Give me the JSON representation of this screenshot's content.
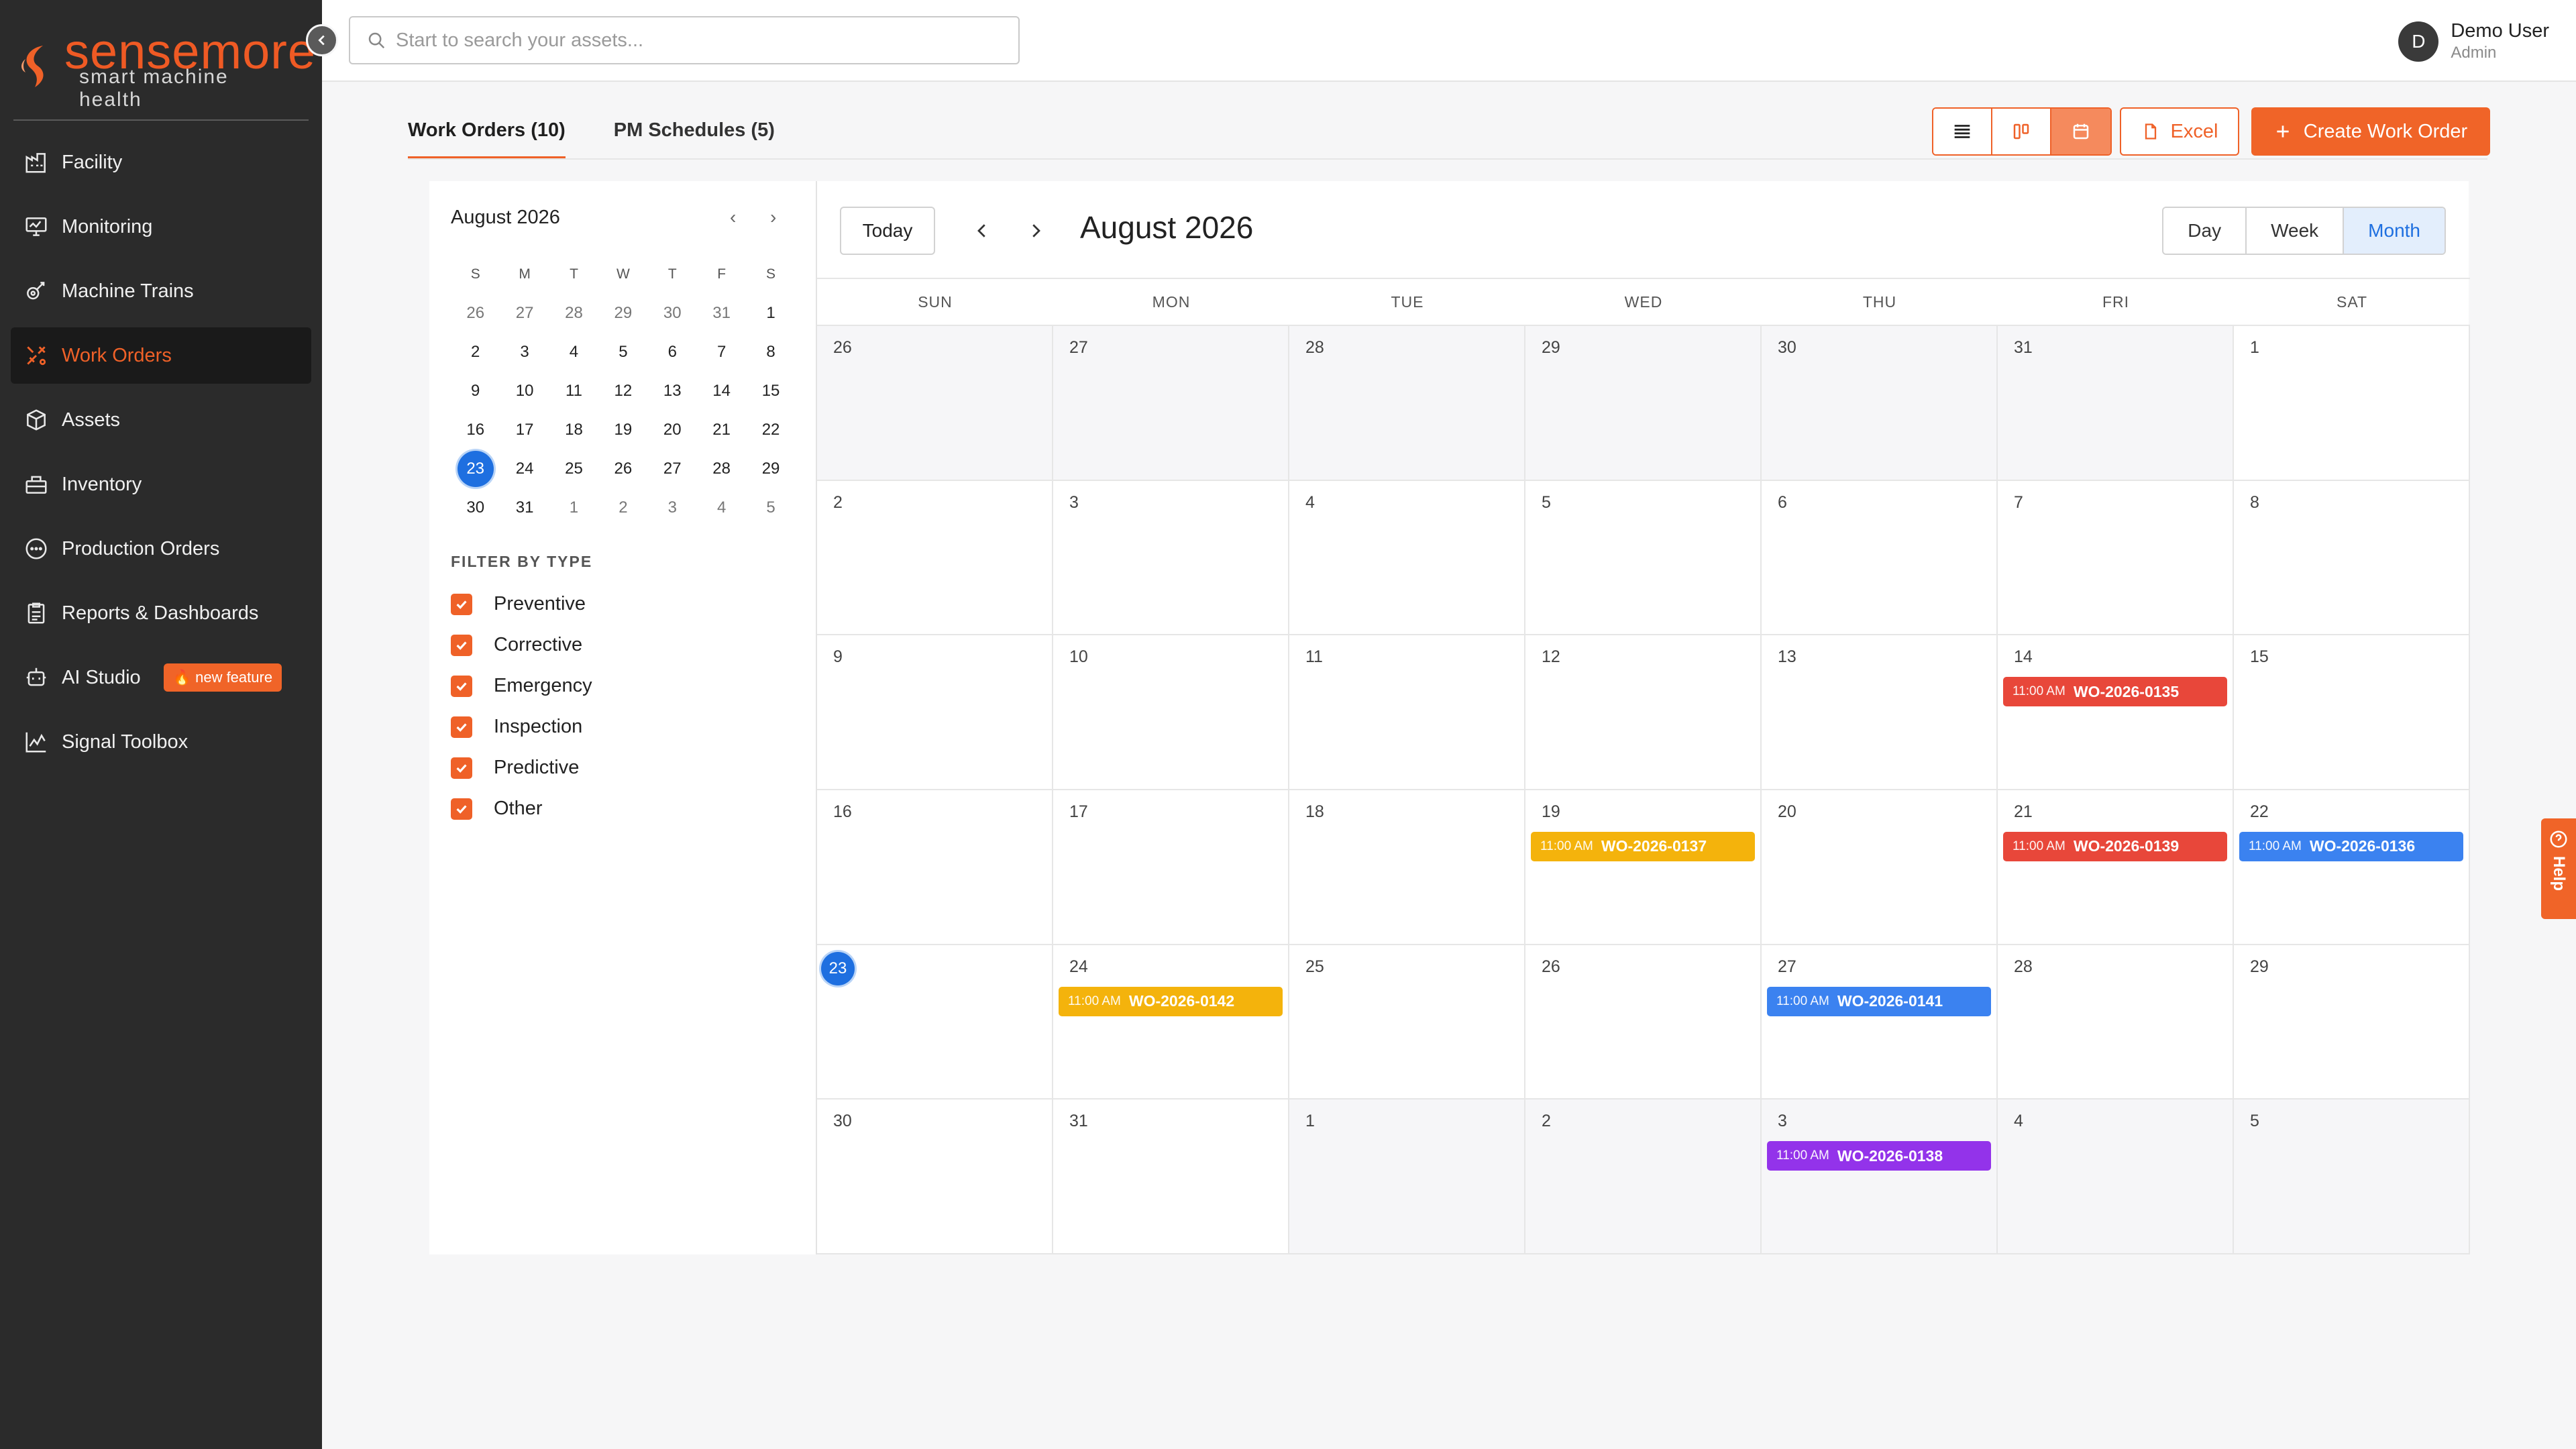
{
  "app": {
    "brand": "sensemore",
    "tagline": "smart machine health",
    "colors": {
      "accent": "#ef6128",
      "sidebar_bg": "#2b2b2b",
      "today_blue": "#1e6fe0"
    }
  },
  "sidebar": {
    "items": [
      {
        "label": "Facility",
        "icon": "facility-icon"
      },
      {
        "label": "Monitoring",
        "icon": "monitoring-icon"
      },
      {
        "label": "Machine Trains",
        "icon": "machine-trains-icon"
      },
      {
        "label": "Work Orders",
        "icon": "work-orders-icon",
        "active": true
      },
      {
        "label": "Assets",
        "icon": "assets-icon"
      },
      {
        "label": "Inventory",
        "icon": "inventory-icon"
      },
      {
        "label": "Production Orders",
        "icon": "production-orders-icon"
      },
      {
        "label": "Reports & Dashboards",
        "icon": "reports-icon"
      },
      {
        "label": "AI Studio",
        "icon": "ai-studio-icon",
        "badge": "new feature"
      },
      {
        "label": "Signal Toolbox",
        "icon": "signal-toolbox-icon"
      }
    ]
  },
  "search": {
    "placeholder": "Start to search your assets..."
  },
  "user": {
    "initial": "D",
    "name": "Demo User",
    "role": "Admin"
  },
  "tabs": [
    {
      "label": "Work Orders (10)",
      "active": true
    },
    {
      "label": "PM Schedules (5)",
      "active": false
    }
  ],
  "actions": {
    "excel": "Excel",
    "create": "Create Work Order",
    "active_view": "calendar"
  },
  "mini_calendar": {
    "title": "August 2026",
    "weekdays": [
      "S",
      "M",
      "T",
      "W",
      "T",
      "F",
      "S"
    ],
    "weeks": [
      [
        "26",
        "27",
        "28",
        "29",
        "30",
        "31",
        "1"
      ],
      [
        "2",
        "3",
        "4",
        "5",
        "6",
        "7",
        "8"
      ],
      [
        "9",
        "10",
        "11",
        "12",
        "13",
        "14",
        "15"
      ],
      [
        "16",
        "17",
        "18",
        "19",
        "20",
        "21",
        "22"
      ],
      [
        "23",
        "24",
        "25",
        "26",
        "27",
        "28",
        "29"
      ],
      [
        "30",
        "31",
        "1",
        "2",
        "3",
        "4",
        "5"
      ]
    ],
    "selected": "23"
  },
  "filter": {
    "title": "FILTER BY TYPE",
    "types": [
      {
        "label": "Preventive",
        "checked": true
      },
      {
        "label": "Corrective",
        "checked": true
      },
      {
        "label": "Emergency",
        "checked": true
      },
      {
        "label": "Inspection",
        "checked": true
      },
      {
        "label": "Predictive",
        "checked": true
      },
      {
        "label": "Other",
        "checked": true
      }
    ]
  },
  "calendar": {
    "today_label": "Today",
    "title": "August 2026",
    "ranges": [
      {
        "label": "Day",
        "active": false
      },
      {
        "label": "Week",
        "active": false
      },
      {
        "label": "Month",
        "active": true
      }
    ],
    "weekdays": [
      "SUN",
      "MON",
      "TUE",
      "WED",
      "THU",
      "FRI",
      "SAT"
    ],
    "days": [
      {
        "d": "26",
        "other": true
      },
      {
        "d": "27",
        "other": true
      },
      {
        "d": "28",
        "other": true
      },
      {
        "d": "29",
        "other": true
      },
      {
        "d": "30",
        "other": true
      },
      {
        "d": "31",
        "other": true
      },
      {
        "d": "1"
      },
      {
        "d": "2"
      },
      {
        "d": "3"
      },
      {
        "d": "4"
      },
      {
        "d": "5"
      },
      {
        "d": "6"
      },
      {
        "d": "7"
      },
      {
        "d": "8"
      },
      {
        "d": "9"
      },
      {
        "d": "10"
      },
      {
        "d": "11"
      },
      {
        "d": "12"
      },
      {
        "d": "13"
      },
      {
        "d": "14",
        "event": {
          "time": "11:00 AM",
          "id": "WO-2026-0135",
          "color": "#e8473a"
        }
      },
      {
        "d": "15"
      },
      {
        "d": "16"
      },
      {
        "d": "17"
      },
      {
        "d": "18"
      },
      {
        "d": "19",
        "event": {
          "time": "11:00 AM",
          "id": "WO-2026-0137",
          "color": "#f4b30c"
        }
      },
      {
        "d": "20"
      },
      {
        "d": "21",
        "event": {
          "time": "11:00 AM",
          "id": "WO-2026-0139",
          "color": "#e8473a"
        }
      },
      {
        "d": "22",
        "event": {
          "time": "11:00 AM",
          "id": "WO-2026-0136",
          "color": "#3b82f0"
        }
      },
      {
        "d": "23",
        "today": true
      },
      {
        "d": "24",
        "event": {
          "time": "11:00 AM",
          "id": "WO-2026-0142",
          "color": "#f4b30c"
        }
      },
      {
        "d": "25"
      },
      {
        "d": "26"
      },
      {
        "d": "27",
        "event": {
          "time": "11:00 AM",
          "id": "WO-2026-0141",
          "color": "#3b82f0"
        }
      },
      {
        "d": "28"
      },
      {
        "d": "29"
      },
      {
        "d": "30"
      },
      {
        "d": "31"
      },
      {
        "d": "1",
        "other": true
      },
      {
        "d": "2",
        "other": true
      },
      {
        "d": "3",
        "other": true,
        "event": {
          "time": "11:00 AM",
          "id": "WO-2026-0138",
          "color": "#9333ea"
        }
      },
      {
        "d": "4",
        "other": true
      },
      {
        "d": "5",
        "other": true
      }
    ]
  },
  "help": {
    "label": "Help"
  }
}
